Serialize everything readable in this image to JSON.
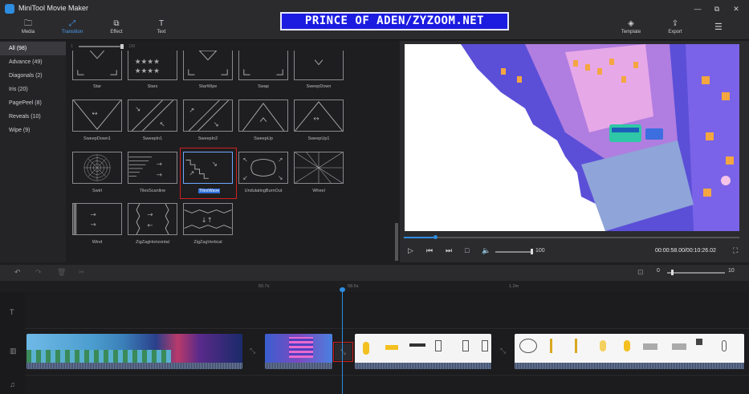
{
  "app": {
    "title": "MiniTool Movie Maker"
  },
  "window": {
    "minimize": "—",
    "maximize": "⧉",
    "close": "✕"
  },
  "toolbar": {
    "items": [
      {
        "label": "Media",
        "icon": "folder-icon",
        "glyph": "🗀"
      },
      {
        "label": "Transition",
        "icon": "transition-icon",
        "glyph": "⤢"
      },
      {
        "label": "Effect",
        "icon": "effect-icon",
        "glyph": "⧉"
      },
      {
        "label": "Text",
        "icon": "text-icon",
        "glyph": "T"
      }
    ],
    "right": [
      {
        "label": "Template",
        "icon": "layers-icon",
        "glyph": "◈"
      },
      {
        "label": "Export",
        "icon": "export-icon",
        "glyph": "⇪"
      }
    ],
    "menu_glyph": "☰"
  },
  "banner": {
    "text": "PRINCE OF ADEN/ZYZOOM.NET"
  },
  "sidebar": {
    "items": [
      {
        "label": "All (98)",
        "selected": true
      },
      {
        "label": "Advance (49)"
      },
      {
        "label": "Diagonals (2)"
      },
      {
        "label": "Iris (20)"
      },
      {
        "label": "PagePeel (8)"
      },
      {
        "label": "Reveals (10)"
      },
      {
        "label": "Wipe (9)"
      }
    ]
  },
  "size_slider": {
    "min": "1",
    "max": "100",
    "value_fraction": 0.95
  },
  "transitions": {
    "row0": [
      "Star",
      "Stars",
      "StarWipe",
      "Swap",
      "SweepDown"
    ],
    "row1": [
      "SweepDown1",
      "SweepIn1",
      "SweepIn2",
      "SweepUp",
      "SweepUp1"
    ],
    "row2": [
      "Swirl",
      "TilesScanline",
      "TilesWave",
      "UndulatingBurnOut",
      "Wheel"
    ],
    "row3": [
      "Wind",
      "ZigZagHorizontal",
      "ZigZagVertical"
    ],
    "selected": "TilesWave"
  },
  "player": {
    "progress_fraction": 0.094,
    "volume": "100",
    "timecode": "00:00:58.00/00:10:26.02",
    "controls": {
      "play": "▷",
      "prev": "⏮",
      "next": "⏭",
      "stop": "□",
      "volume": "🔈",
      "fullscreen": "⛶"
    }
  },
  "timeline": {
    "tools": {
      "undo": "↶",
      "redo": "↷",
      "delete": "🗑",
      "cut": "✂",
      "fit": "⊡"
    },
    "zoom": {
      "min": "0",
      "max": "10"
    },
    "ruler": [
      "50.7s",
      "58.6s",
      "1.2m"
    ],
    "track_icons": {
      "text": "T",
      "video": "▥",
      "music": "♫"
    }
  },
  "colors": {
    "accent": "#2e8de0",
    "highlight": "#d02020",
    "background": "#1e1e20"
  }
}
